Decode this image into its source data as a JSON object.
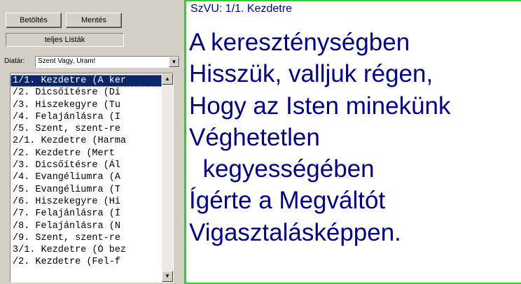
{
  "toolbar": {
    "load_label": "Betöltés",
    "save_label": "Mentés",
    "lists_label": "teljes Listák"
  },
  "diatar": {
    "label": "Diatár:",
    "selected": "Szent Vagy, Uram!"
  },
  "list": {
    "items": [
      "1/1. Kezdetre (A ker",
      " /2. Dicsőítésre (Di",
      " /3. Hiszekegyre (Tu",
      " /4. Felajánlásra (I",
      " /5. Szent, szent-re",
      "2/1. Kezdetre (Harma",
      " /2. Kezdetre (Mert ",
      " /3. Dicsőítésre (Ál",
      " /4. Evangéliumra (A",
      " /5. Evangéliumra (T",
      " /6. Hiszekegyre (Hi",
      " /7. Felajánlásra (Í",
      " /8. Felajánlásra (N",
      " /9. Szent, szent-re",
      "3/1. Kezdetre (Ó bez",
      " /2. Kezdetre (Fel-f"
    ]
  },
  "preview": {
    "header": "SzVU: 1/1. Kezdetre",
    "lines": [
      "A kereszténységben",
      "Hisszük, valljuk régen,",
      "Hogy az Isten minekünk",
      "Véghetetlen",
      "  kegyességében",
      "Ígérte a Megváltót",
      "Vigasztalásképpen."
    ]
  },
  "colors": {
    "selection": "#0a246a",
    "text": "#000080",
    "border": "#33cc33"
  }
}
